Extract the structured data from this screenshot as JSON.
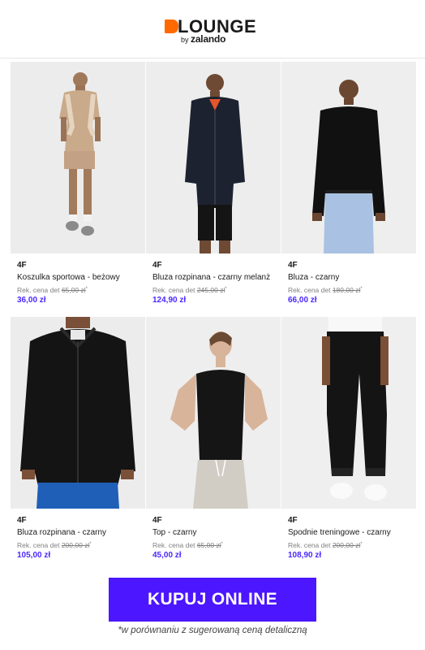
{
  "header": {
    "logo_word": "LOUNGE",
    "logo_by": "by",
    "logo_brand": "zalando",
    "accent": "#ff6900"
  },
  "products": [
    {
      "brand": "4F",
      "name": "Koszulka sportowa - beżowy",
      "old_label": "Rek. cena det",
      "old_price": "65,00 zł",
      "old_mark": "*",
      "price": "36,00 zł",
      "image": "woman-beige-outfit"
    },
    {
      "brand": "4F",
      "name": "Bluza rozpinana - czarny melanż",
      "old_label": "Rek. cena det",
      "old_price": "245,00 zł",
      "old_mark": "*",
      "price": "124,90 zł",
      "image": "woman-black-zip-hoodie"
    },
    {
      "brand": "4F",
      "name": "Bluza - czarny",
      "old_label": "Rek. cena det",
      "old_price": "180,00 zł",
      "old_mark": "*",
      "price": "66,00 zł",
      "image": "woman-black-sweatshirt"
    },
    {
      "brand": "4F",
      "name": "Bluza rozpinana - czarny",
      "old_label": "Rek. cena det",
      "old_price": "200,00 zł",
      "old_mark": "*",
      "price": "105,00 zł",
      "image": "man-black-zip-hoodie"
    },
    {
      "brand": "4F",
      "name": "Top - czarny",
      "old_label": "Rek. cena det",
      "old_price": "65,00 zł",
      "old_mark": "*",
      "price": "45,00 zł",
      "image": "woman-black-top"
    },
    {
      "brand": "4F",
      "name": "Spodnie treningowe - czarny",
      "old_label": "Rek. cena det",
      "old_price": "200,00 zł",
      "old_mark": "*",
      "price": "108,90 zł",
      "image": "black-joggers"
    }
  ],
  "cta": {
    "label": "KUPUJ ONLINE",
    "color": "#4c16ff"
  },
  "footnote": "*w porównaniu z sugerowaną ceną detaliczną",
  "colors": {
    "price": "#4a28ff",
    "photo_bg": "#ededed"
  }
}
